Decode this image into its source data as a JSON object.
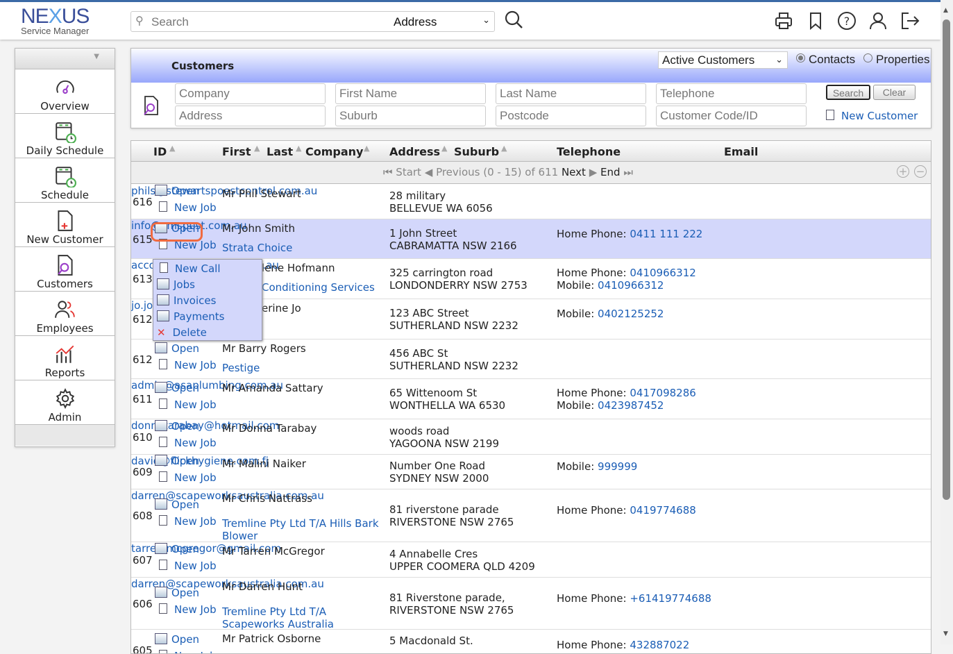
{
  "header": {
    "logo_text": "NEXUS",
    "logo_sub": "Service Manager",
    "search_placeholder": "Search",
    "search_field": "Address",
    "icons": [
      "search-icon",
      "print-icon",
      "bookmark-icon",
      "help-icon",
      "user-icon",
      "logout-icon"
    ]
  },
  "sidebar": {
    "items": [
      {
        "label": "Overview",
        "icon": "gauge-icon"
      },
      {
        "label": "Daily Schedule",
        "icon": "calendar-clock-icon"
      },
      {
        "label": "Schedule",
        "icon": "calendar-clock-icon"
      },
      {
        "label": "New Customer",
        "icon": "add-document-icon"
      },
      {
        "label": "Customers",
        "icon": "search-document-icon"
      },
      {
        "label": "Employees",
        "icon": "users-icon"
      },
      {
        "label": "Reports",
        "icon": "chart-icon"
      },
      {
        "label": "Admin",
        "icon": "gear-icon"
      }
    ]
  },
  "filter": {
    "title": "Customers",
    "status_select": "Active Customers",
    "radio_contacts": "Contacts",
    "radio_properties": "Properties",
    "radio_selected": "Contacts",
    "placeholders": {
      "company": "Company",
      "first_name": "First Name",
      "last_name": "Last Name",
      "telephone": "Telephone",
      "address": "Address",
      "suburb": "Suburb",
      "postcode": "Postcode",
      "code": "Customer Code/ID"
    },
    "search": "Search",
    "clear": "Clear",
    "new_customer": "New Customer"
  },
  "grid": {
    "columns": {
      "id": "ID",
      "first": "First",
      "last": "Last",
      "company": "Company",
      "address": "Address",
      "suburb": "Suburb",
      "telephone": "Telephone",
      "email": "Email"
    },
    "pager": {
      "start": "Start",
      "previous": "Previous",
      "range": "(0 - 15) of 611",
      "next": "Next",
      "end": "End"
    },
    "open_label": "Open",
    "newjob_label": "New Job",
    "rows": [
      {
        "id": "616",
        "name": "Mr Phil Stewart",
        "company": "",
        "address": [
          "28 military",
          "BELLEVUE WA 6056"
        ],
        "phones": [],
        "email": "phils@stewartspoestcontrol.com.au"
      },
      {
        "id": "615",
        "name": "Mr John Smith",
        "company": "Strata Choice",
        "address": [
          "1 John Street",
          "CABRAMATTA NSW 2166"
        ],
        "phones": [
          {
            "label": "Home Phone:",
            "value": "0411 111 222"
          }
        ],
        "email": "info@cmspest.com.au",
        "selected": true
      },
      {
        "id": "613",
        "name": "lene Hofmann",
        "company": "Conditioning Services",
        "address": [
          "325 carrington road",
          "LONDONDERRY NSW 2753"
        ],
        "phones": [
          {
            "label": "Home Phone:",
            "value": "0410966312"
          },
          {
            "label": "Mobile:",
            "value": "0410966312"
          }
        ],
        "email": "accounts@hofaircon.com.au",
        "obscured": true
      },
      {
        "id": "612",
        "name": "erine Jo",
        "company": "",
        "address": [
          "123 ABC Street",
          "SUTHERLAND NSW 2232"
        ],
        "phones": [
          {
            "label": "Mobile:",
            "value": "0402125252"
          }
        ],
        "email": "jo.jo@gmail.com",
        "obscured": true
      },
      {
        "id": "612",
        "name": "Mr Barry Rogers",
        "company": "Pestige",
        "address": [
          "456 ABC St",
          "SUTHERLAND NSW 2232"
        ],
        "phones": [],
        "email": ""
      },
      {
        "id": "611",
        "name": "Mr Amanda Sattary",
        "company": "",
        "address": [
          "65 Wittenoom St",
          "WONTHELLA WA 6530"
        ],
        "phones": [
          {
            "label": "Home Phone:",
            "value": "0417098286"
          },
          {
            "label": "Mobile:",
            "value": "0423987452"
          }
        ],
        "email": "admin@asaplumbing.com.au"
      },
      {
        "id": "610",
        "name": "Mr Donna Tarabay",
        "company": "",
        "address": [
          "woods road",
          "YAGOONA NSW 2199"
        ],
        "phones": [],
        "email": "donnatarabay@hotmail.com"
      },
      {
        "id": "609",
        "name": "Mr Malini Naiker",
        "company": "",
        "address": [
          "Number One Road",
          "SYDNEY NSW 2000"
        ],
        "phones": [
          {
            "label": "Mobile:",
            "value": "999999"
          }
        ],
        "email": "david@flickhygiene.com.fj"
      },
      {
        "id": "608",
        "name": "Mr Chris Nattrass",
        "company": "Tremline Pty Ltd T/A Hills Bark Blower",
        "address": [
          "81 riverstone parade",
          "RIVERSTONE NSW 2765"
        ],
        "phones": [
          {
            "label": "Home Phone:",
            "value": "0419774688"
          }
        ],
        "email": "darren@scapeworksaustralia.com.au"
      },
      {
        "id": "607",
        "name": "Mr Tarren McGregor",
        "company": "",
        "address": [
          "4 Annabelle Cres",
          "UPPER COOMERA QLD 4209"
        ],
        "phones": [],
        "email": "tarren.mcgregor@gmail.com"
      },
      {
        "id": "606",
        "name": "Mr Darren Hunt",
        "company": "Tremline Pty Ltd T/A Scapeworks Australia",
        "address": [
          "81 Riverstone parade,",
          "RIVERSTONE NSW 2765"
        ],
        "phones": [
          {
            "label": "Home Phone:",
            "value": "+61419774688"
          }
        ],
        "email": "darren@scapeworksaustralia.com.au"
      },
      {
        "id": "605",
        "name": "Mr Patrick Osborne",
        "company": "",
        "address": [
          "5 Macdonald St."
        ],
        "phones": [
          {
            "label": "Home Phone:",
            "value": "432887022"
          }
        ],
        "email": ""
      }
    ]
  },
  "context_menu": {
    "items": [
      {
        "label": "New Call",
        "icon": "document-icon"
      },
      {
        "label": "Jobs",
        "icon": "open-icon"
      },
      {
        "label": "Invoices",
        "icon": "open-icon"
      },
      {
        "label": "Payments",
        "icon": "open-icon"
      },
      {
        "label": "Delete",
        "icon": "delete-icon"
      }
    ]
  },
  "colors": {
    "accent": "#1a5db5",
    "highlight_row": "#d3d7fb",
    "header_band": "#98a7fb",
    "focus_ring": "#f06a40"
  }
}
